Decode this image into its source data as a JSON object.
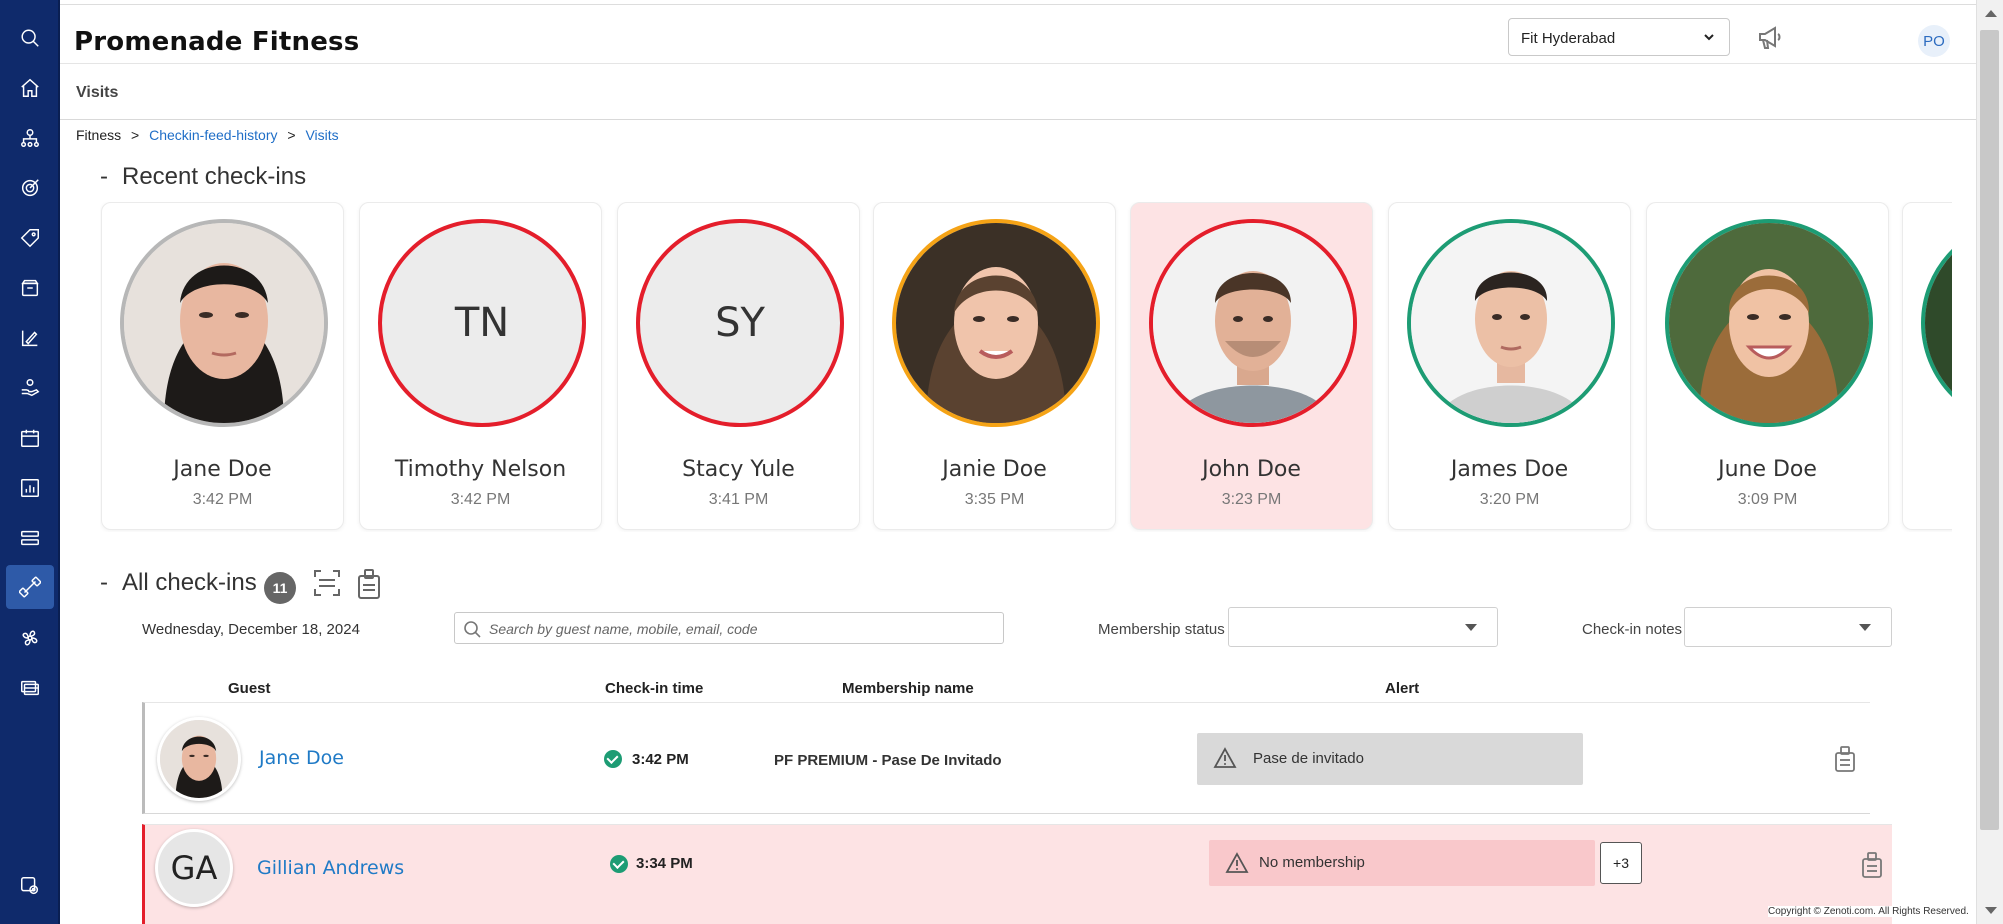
{
  "app": {
    "title": "Promenade Fitness"
  },
  "header": {
    "location": "Fit Hyderabad",
    "user_initials": "PO"
  },
  "subheader": {
    "page_name": "Visits"
  },
  "breadcrumb": {
    "root": "Fitness",
    "sep": ">",
    "link1": "Checkin-feed-history",
    "link2": "Visits"
  },
  "sidebar": {
    "items": [
      {
        "icon": "search-icon"
      },
      {
        "icon": "home-icon"
      },
      {
        "icon": "org-chart-icon"
      },
      {
        "icon": "target-icon"
      },
      {
        "icon": "tag-icon"
      },
      {
        "icon": "box-icon"
      },
      {
        "icon": "chart-edit-icon"
      },
      {
        "icon": "hand-care-icon"
      },
      {
        "icon": "calendar-icon"
      },
      {
        "icon": "report-icon"
      },
      {
        "icon": "list-icon"
      },
      {
        "icon": "dumbbell-icon"
      },
      {
        "icon": "fan-icon"
      },
      {
        "icon": "cards-icon"
      },
      {
        "icon": "settings-icon"
      }
    ]
  },
  "recent": {
    "title": "Recent check-ins",
    "dash": "-",
    "cards": [
      {
        "name": "Jane Doe",
        "time": "3:42 PM",
        "initials": "",
        "ring": "grey"
      },
      {
        "name": "Timothy Nelson",
        "time": "3:42 PM",
        "initials": "TN",
        "ring": "red"
      },
      {
        "name": "Stacy Yule",
        "time": "3:41 PM",
        "initials": "SY",
        "ring": "red"
      },
      {
        "name": "Janie Doe",
        "time": "3:35 PM",
        "initials": "",
        "ring": "orange"
      },
      {
        "name": "John Doe",
        "time": "3:23 PM",
        "initials": "",
        "ring": "red",
        "highlight": true
      },
      {
        "name": "James Doe",
        "time": "3:20 PM",
        "initials": "",
        "ring": "green"
      },
      {
        "name": "June Doe",
        "time": "3:09 PM",
        "initials": "",
        "ring": "green"
      }
    ]
  },
  "all": {
    "title": "All check-ins",
    "dash": "-",
    "count": "11",
    "date": "Wednesday, December 18, 2024",
    "search_placeholder": "Search by guest name, mobile, email, code",
    "membership_status_label": "Membership status",
    "checkin_notes_label": "Check-in notes",
    "columns": {
      "guest": "Guest",
      "checkin_time": "Check-in time",
      "membership_name": "Membership name",
      "alert": "Alert"
    },
    "rows": [
      {
        "initials": "",
        "name": "Jane Doe",
        "time": "3:42 PM",
        "membership": "PF PREMIUM - Pase De Invitado",
        "alert": "Pase de invitado",
        "extra": ""
      },
      {
        "initials": "GA",
        "name": "Gillian Andrews",
        "time": "3:34 PM",
        "membership": "",
        "alert": "No membership",
        "extra": "+3"
      }
    ]
  },
  "footer": {
    "copyright": "Copyright © Zenoti.com. All Rights Reserved."
  },
  "colors": {
    "sidebar": "#0f2a6b",
    "link": "#1f6ec7",
    "ring_red": "#e41e2b",
    "ring_orange": "#f5a316",
    "ring_green": "#1d9c74",
    "alert_bg": "#fde3e4"
  }
}
